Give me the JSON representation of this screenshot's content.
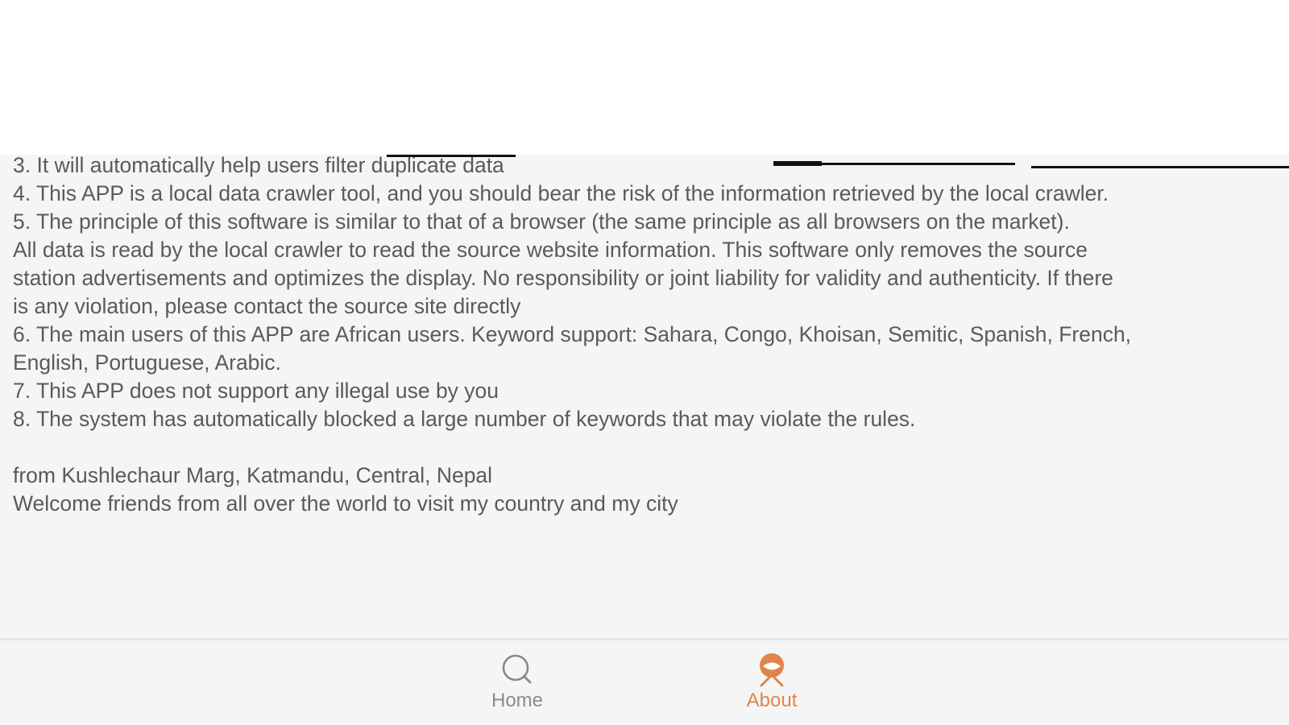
{
  "content": {
    "lines": [
      "3. It will automatically help users filter duplicate data",
      "4. This APP is a local data crawler tool, and you should bear the risk of the information retrieved by the local crawler.",
      "5. The principle of this software is similar to that of a browser (the same principle as all browsers on the market).",
      "All data is read by the local crawler to read the source website information. This software only removes the source",
      "station advertisements and optimizes the display. No responsibility or joint liability for validity and authenticity. If there",
      "is any violation, please contact the source site directly",
      "6. The main users of this APP are African users. Keyword support: Sahara, Congo, Khoisan, Semitic, Spanish, French,",
      "English, Portuguese, Arabic.",
      "7. This APP does not support any illegal use by you",
      "8. The system has automatically blocked a large number of keywords that may violate the rules.",
      "",
      "from Kushlechaur Marg, Katmandu, Central, Nepal",
      "Welcome friends from all over the world to visit my country and my city"
    ]
  },
  "tabbar": {
    "home": {
      "label": "Home",
      "icon": "search-icon",
      "active": false
    },
    "about": {
      "label": "About",
      "icon": "about-icon",
      "active": true
    }
  },
  "colors": {
    "text": "#5a5a5a",
    "inactive_tab": "#8a8a8a",
    "accent": "#e0844a",
    "background": "#f5f5f5"
  }
}
